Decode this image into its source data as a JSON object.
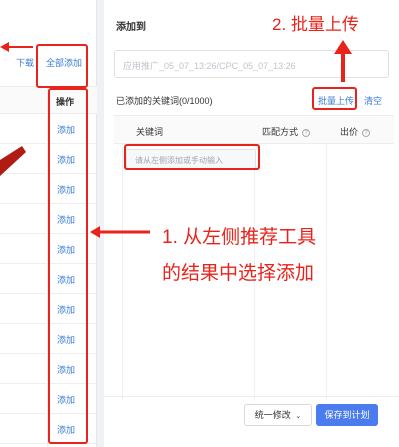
{
  "left": {
    "download_label": "下载",
    "add_all_label": "全部添加",
    "ops_header": "操作",
    "rows": [
      "添加",
      "添加",
      "添加",
      "添加",
      "添加",
      "添加",
      "添加",
      "添加",
      "添加",
      "添加",
      "添加"
    ]
  },
  "right": {
    "title": "添加到",
    "plan_placeholder": "应用推广_05_07_13:26/CPC_05_07_13:26",
    "added_label": "已添加的关键词(0/1000)",
    "batch_upload_label": "批量上传",
    "clear_label": "清空",
    "col_keyword": "关键词",
    "col_match": "匹配方式",
    "col_bid": "出价",
    "help_glyph": "?",
    "kw_placeholder": "请从左侧添加或手动输入",
    "unify_label": "统一修改",
    "save_label": "保存到计划"
  },
  "annotations": {
    "step2": "2. 批量上传",
    "step1_line1": "1. 从左侧推荐工具",
    "step1_line2": "的结果中选择添加",
    "accent_color": "#e8231b"
  }
}
